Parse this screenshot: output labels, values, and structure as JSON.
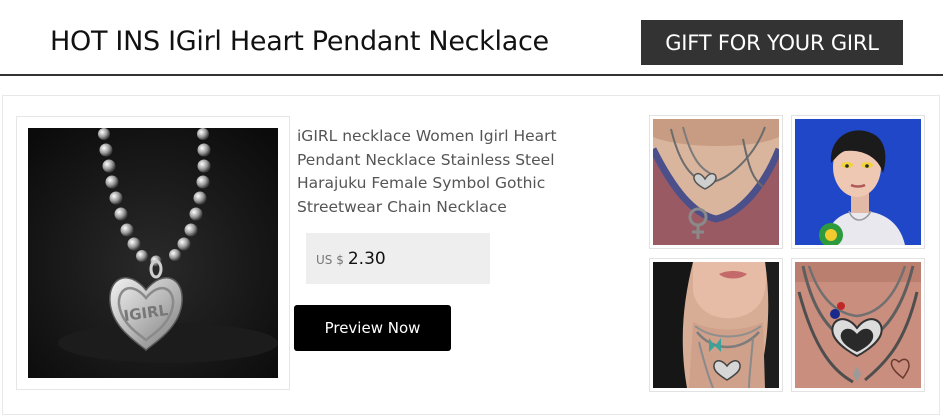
{
  "header": {
    "title": "HOT INS IGirl Heart Pendant Necklace",
    "badge": "GIFT FOR YOUR GIRL"
  },
  "product": {
    "description": "iGIRL necklace Women Igirl Heart Pendant Necklace Stainless Steel Harajuku Female Symbol Gothic Streetwear Chain Necklace",
    "currency": "US $",
    "price": "2.30",
    "pendant_engraving": "IGIRL",
    "button_label": "Preview Now"
  },
  "images": {
    "main": "heart-pendant-necklace-photo",
    "thumbnails": [
      "model-neck-chains-photo",
      "model-blue-wall-photo",
      "model-lips-chains-photo",
      "layered-chains-closeup-photo"
    ]
  },
  "colors": {
    "header_badge_bg": "#333333",
    "button_bg": "#000000",
    "price_box_bg": "#eeeeee",
    "description_text": "#555555"
  }
}
